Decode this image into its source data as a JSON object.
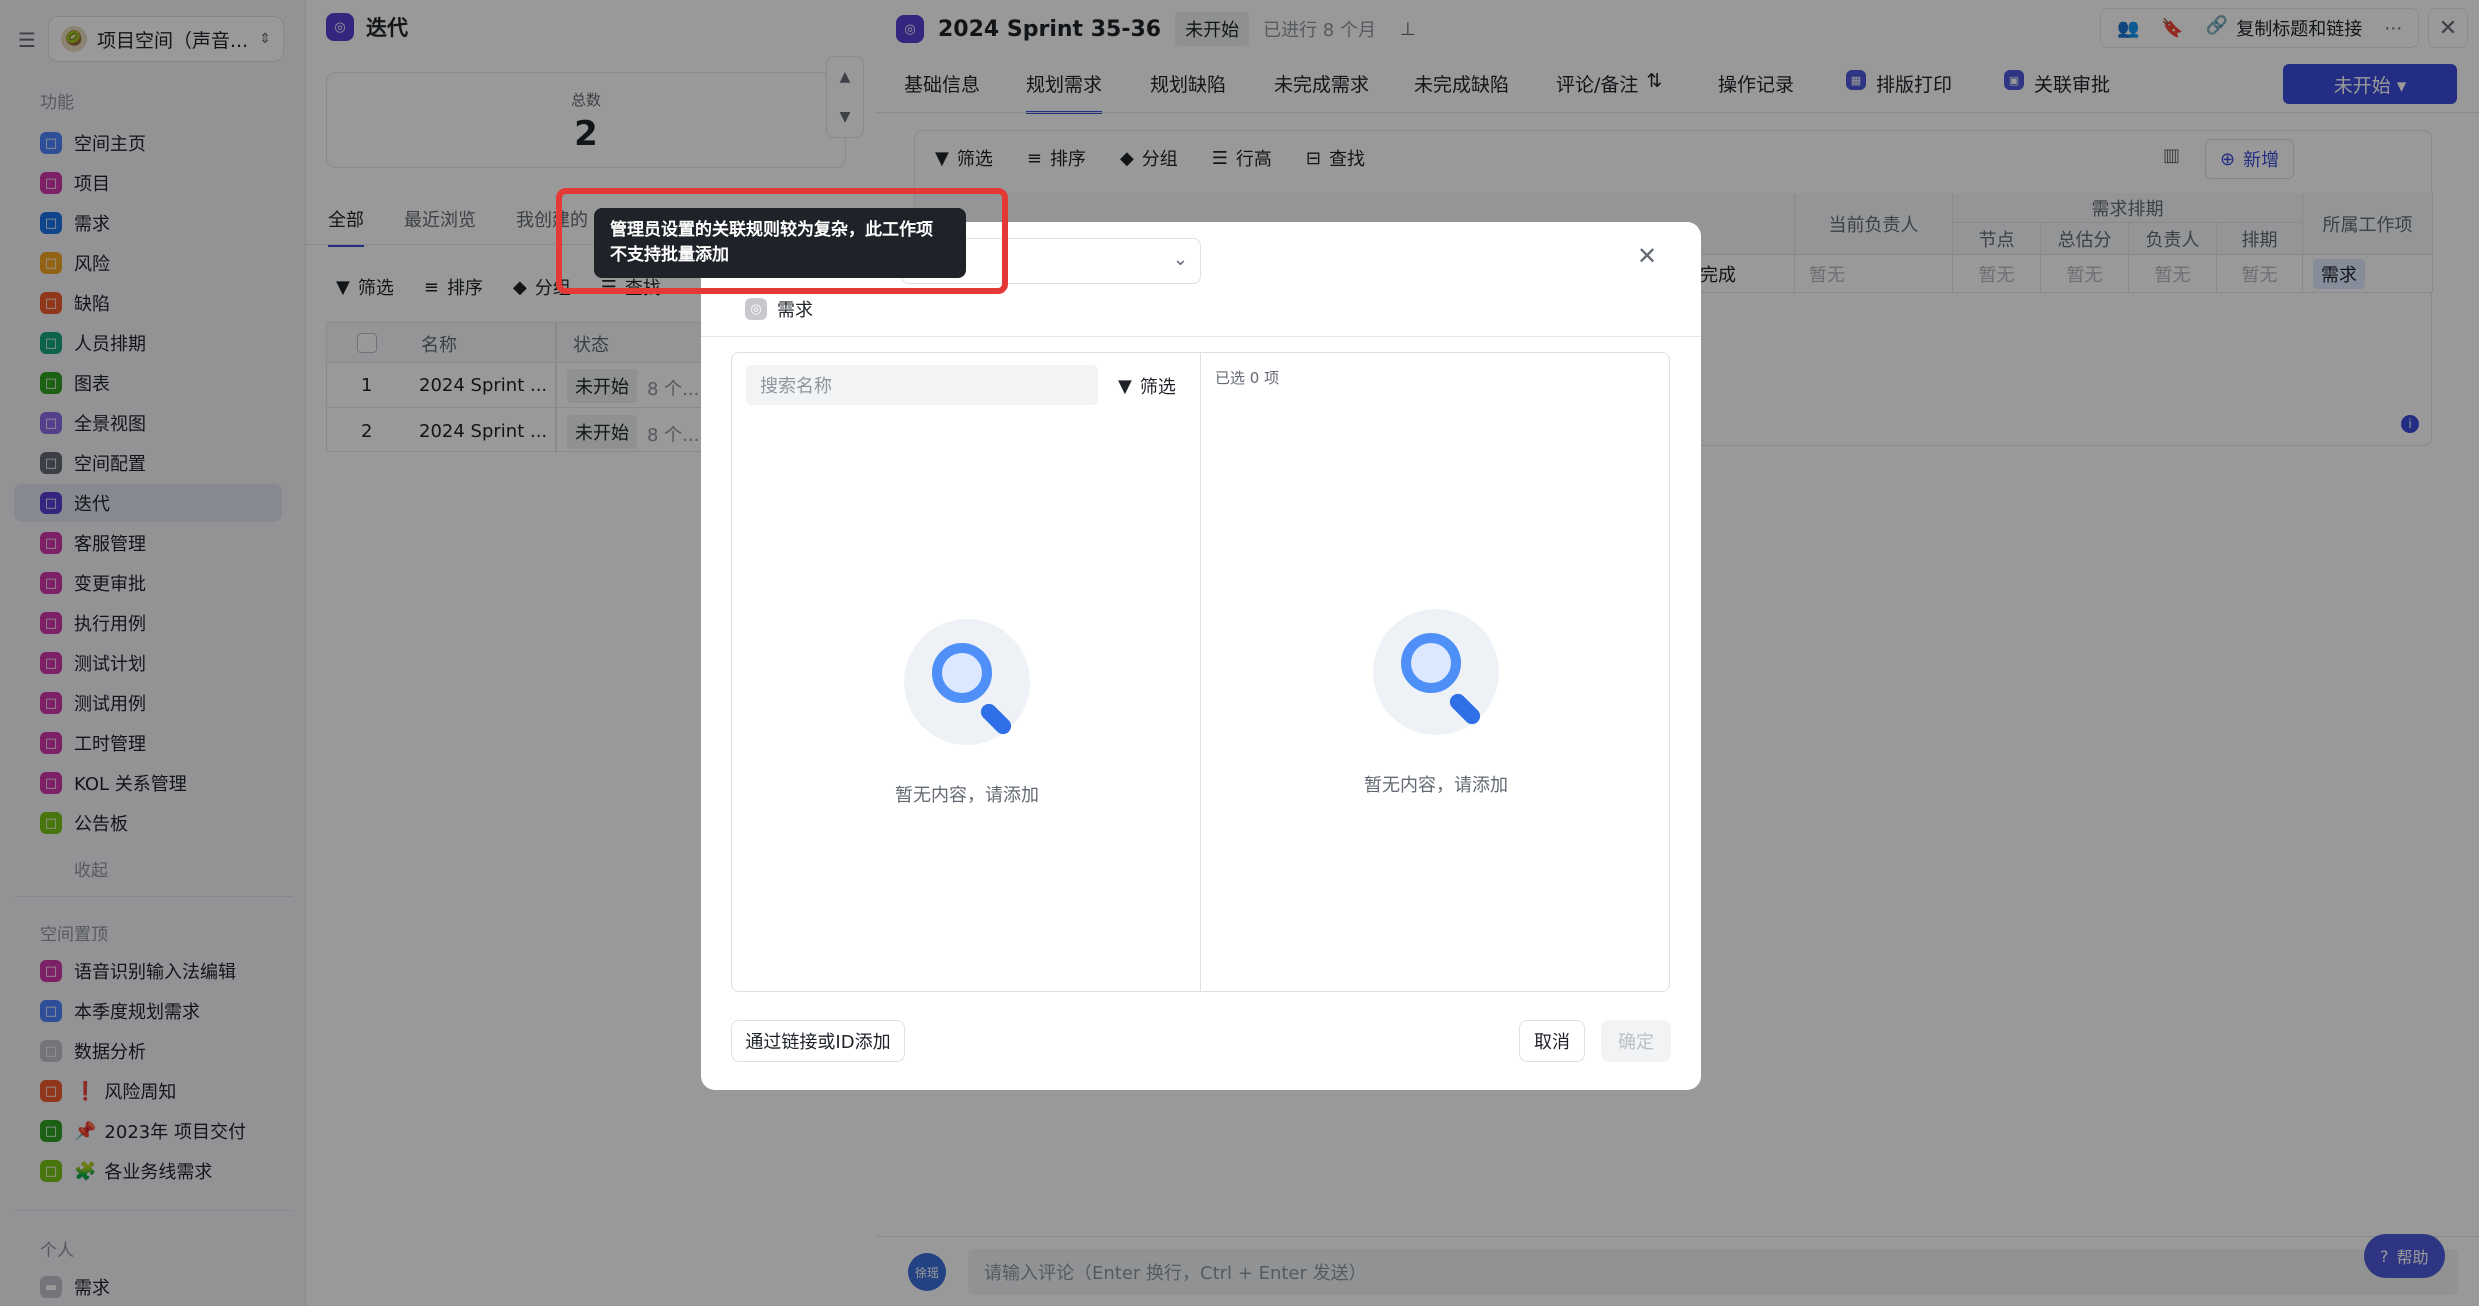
{
  "sidebar": {
    "workspace": "项目空间（声音...",
    "section_function": "功能",
    "items": [
      {
        "label": "空间主页",
        "color": "#4e83fd"
      },
      {
        "label": "项目",
        "color": "#d136a8"
      },
      {
        "label": "需求",
        "color": "#1c73e8"
      },
      {
        "label": "风险",
        "color": "#f5a623"
      },
      {
        "label": "缺陷",
        "color": "#f05a2e"
      },
      {
        "label": "人员排期",
        "color": "#14a67c"
      },
      {
        "label": "图表",
        "color": "#2ea121"
      },
      {
        "label": "全景视图",
        "color": "#8c6ae8"
      },
      {
        "label": "空间配置",
        "color": "#646a73"
      },
      {
        "label": "迭代",
        "color": "#5b3fd4"
      },
      {
        "label": "客服管理",
        "color": "#d136a8"
      },
      {
        "label": "变更审批",
        "color": "#d136a8"
      },
      {
        "label": "执行用例",
        "color": "#d136a8"
      },
      {
        "label": "测试计划",
        "color": "#d136a8"
      },
      {
        "label": "测试用例",
        "color": "#d136a8"
      },
      {
        "label": "工时管理",
        "color": "#d136a8"
      },
      {
        "label": "KOL 关系管理",
        "color": "#d136a8"
      },
      {
        "label": "公告板",
        "color": "#7bc41a"
      }
    ],
    "collapse": "收起",
    "section_pinned": "空间置顶",
    "pinned": [
      {
        "label": "语音识别输入法编辑",
        "color": "#d136a8",
        "prefix": ""
      },
      {
        "label": "本季度规划需求",
        "color": "#4e83fd",
        "prefix": ""
      },
      {
        "label": "数据分析",
        "color": "#c0c4cc",
        "prefix": ""
      },
      {
        "label": "风险周知",
        "color": "#f05a2e",
        "prefix": "❗"
      },
      {
        "label": "2023年 项目交付",
        "color": "#2ea121",
        "prefix": "📌"
      },
      {
        "label": "各业务线需求",
        "color": "#7bc41a",
        "prefix": "🧩"
      }
    ],
    "section_personal": "个人",
    "personal": [
      {
        "label": "需求"
      }
    ]
  },
  "list": {
    "title": "迭代",
    "total_label": "总数",
    "total_value": "2",
    "tabs": [
      "全部",
      "最近浏览",
      "我创建的"
    ],
    "toolbar": [
      "筛选",
      "排序",
      "分组",
      "查找"
    ],
    "columns": [
      "名称",
      "状态"
    ],
    "rows": [
      {
        "no": "1",
        "name": "2024 Sprint ...",
        "status": "未开始",
        "extra": "8 个..."
      },
      {
        "no": "2",
        "name": "2024 Sprint ...",
        "status": "未开始",
        "extra": "8 个..."
      }
    ]
  },
  "detail": {
    "title": "2024 Sprint 35-36",
    "status": "未开始",
    "progress": "已进行 8 个月",
    "copy_link": "复制标题和链接",
    "tabs": [
      "基础信息",
      "规划需求",
      "规划缺陷",
      "未完成需求",
      "未完成缺陷",
      "评论/备注",
      "操作记录",
      "排版打印",
      "关联审批"
    ],
    "status_button": "未开始 ▾",
    "toolbar": [
      "筛选",
      "排序",
      "分组",
      "行高",
      "查找"
    ],
    "add_button": "新增",
    "table": {
      "col_owner": "当前负责人",
      "col_schedule": "需求排期",
      "sub_cols": [
        "节点",
        "总估分",
        "负责人",
        "排期"
      ],
      "col_type": "所属工作项",
      "row_state": "待完成",
      "row_owner": "暂无",
      "row_sub": [
        "暂无",
        "暂无",
        "暂无",
        "暂无"
      ],
      "row_type": "需求"
    },
    "comment_avatar": "徐瑶",
    "comment_placeholder": "请输入评论（Enter 换行，Ctrl + Enter 发送）",
    "help": "帮助"
  },
  "tooltip": {
    "line1": "管理员设置的关联规则较为复杂，此工作项",
    "line2": "不支持批量添加"
  },
  "modal": {
    "chip": "需求",
    "search_placeholder": "搜索名称",
    "filter": "筛选",
    "selected": "已选 0 项",
    "empty_left": "暂无内容，请添加",
    "empty_right": "暂无内容，请添加",
    "link_add": "通过链接或ID添加",
    "cancel": "取消",
    "confirm": "确定"
  }
}
